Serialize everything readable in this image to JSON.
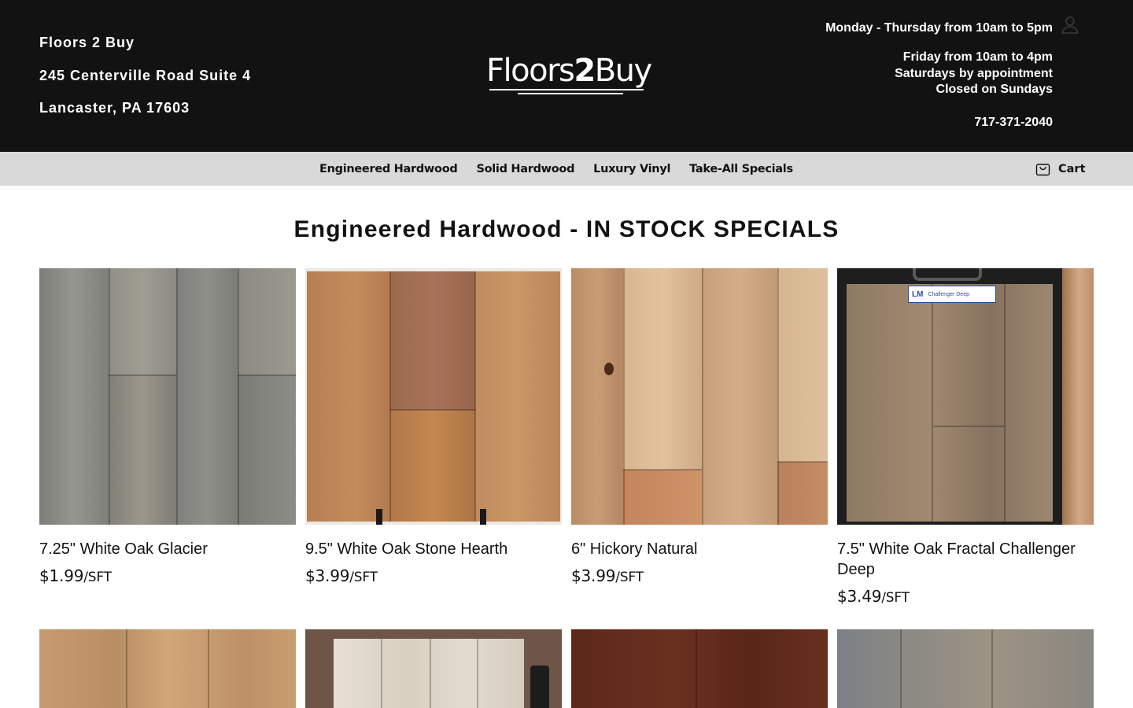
{
  "header": {
    "store_name": "Floors 2 Buy",
    "address_line1": "245 Centerville Road Suite 4",
    "address_line2": "Lancaster, PA 17603",
    "logo_text_a": "Floors",
    "logo_text_b": "2",
    "logo_text_c": "Buy",
    "hours_line1": "Monday - Thursday from 10am to 5pm",
    "hours_line2": "Friday from 10am to 4pm",
    "hours_line3": "Saturdays by appointment",
    "hours_line4": "Closed on Sundays",
    "phone": "717-371-2040",
    "account_icon": "user-icon"
  },
  "nav": {
    "items": [
      {
        "label": "Engineered Hardwood"
      },
      {
        "label": "Solid Hardwood"
      },
      {
        "label": "Luxury Vinyl"
      },
      {
        "label": "Take-All Specials"
      }
    ],
    "cart_label": "Cart",
    "cart_icon": "cart-icon"
  },
  "main": {
    "title": "Engineered Hardwood - IN STOCK SPECIALS",
    "products": [
      {
        "title": "7.25\" White Oak Glacier",
        "price": "$1.99",
        "unit": "/SFT"
      },
      {
        "title": "9.5\" White Oak Stone Hearth",
        "price": "$3.99",
        "unit": "/SFT"
      },
      {
        "title": "6\" Hickory Natural",
        "price": "$3.99",
        "unit": "/SFT"
      },
      {
        "title": "7.5\" White Oak Fractal Challenger Deep",
        "price": "$3.49",
        "unit": "/SFT"
      }
    ],
    "sample_sign_brand": "LM",
    "sample_sign_text": "Challenger Deep"
  }
}
